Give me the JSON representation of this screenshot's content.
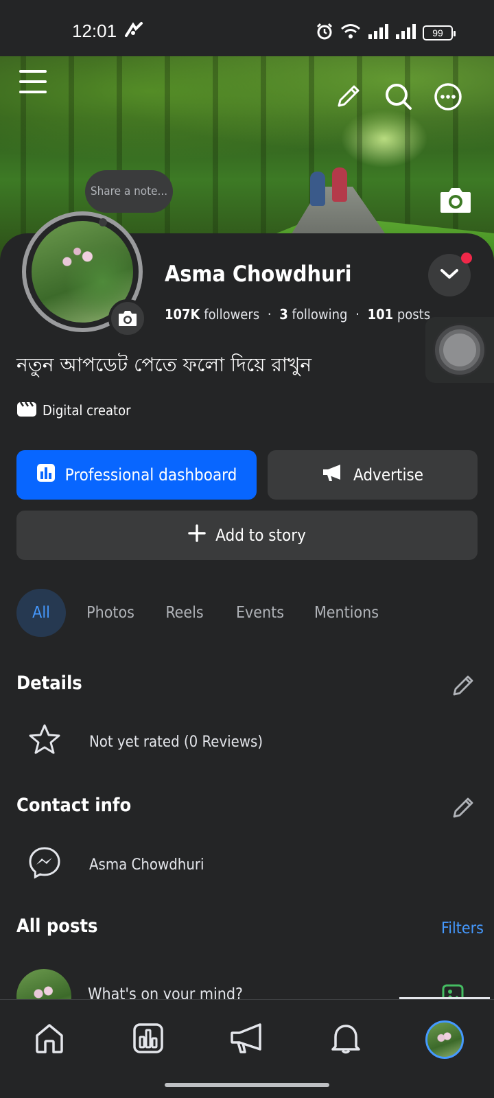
{
  "status_bar": {
    "time": "12:01",
    "battery": "99"
  },
  "cover": {
    "note_placeholder": "Share a note..."
  },
  "profile": {
    "name": "Asma Chowdhuri",
    "followers_count": "107K",
    "followers_label": "followers",
    "following_count": "3",
    "following_label": "following",
    "posts_count": "101",
    "posts_label": "posts",
    "separator": "·",
    "bio": "নতুন আপডেট পেতে ফলো দিয়ে রাখুন",
    "category": "Digital creator"
  },
  "actions": {
    "dashboard_label": "Professional dashboard",
    "advertise_label": "Advertise",
    "add_story_label": "Add to story"
  },
  "tabs": [
    {
      "label": "All",
      "active": true
    },
    {
      "label": "Photos",
      "active": false
    },
    {
      "label": "Reels",
      "active": false
    },
    {
      "label": "Events",
      "active": false
    },
    {
      "label": "Mentions",
      "active": false
    }
  ],
  "details": {
    "title": "Details",
    "rating_text": "Not yet rated (0 Reviews)"
  },
  "contact_info": {
    "title": "Contact info",
    "messenger_name": "Asma Chowdhuri"
  },
  "all_posts": {
    "title": "All posts",
    "filters_label": "Filters",
    "composer_prompt": "What's on your mind?"
  },
  "colors": {
    "accent": "#0866ff",
    "link": "#4599ff",
    "background": "#242526",
    "surface": "#3a3b3c",
    "notification": "#f02849"
  },
  "bottom_nav": [
    {
      "icon": "home-icon"
    },
    {
      "icon": "dashboard-icon"
    },
    {
      "icon": "megaphone-icon"
    },
    {
      "icon": "bell-icon"
    },
    {
      "icon": "profile-avatar"
    }
  ]
}
